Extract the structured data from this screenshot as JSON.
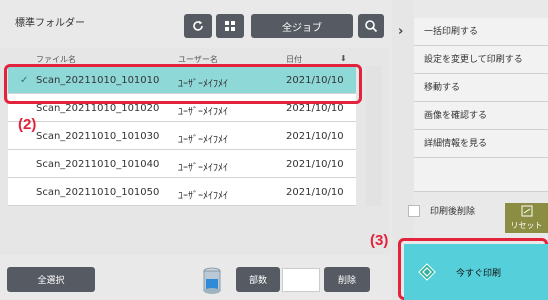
{
  "header": {
    "folder_title": "標準フォルダー",
    "all_jobs_label": "全ジョブ"
  },
  "columns": {
    "name": "ファイル名",
    "user": "ユーザー名",
    "date": "日付"
  },
  "files": [
    {
      "name": "Scan_20211010_101010",
      "user": "ﾕｰｻﾞｰﾒｲﾌﾒｲ",
      "date": "2021/10/10",
      "selected": true,
      "check": "✓"
    },
    {
      "name": "Scan_20211010_101020",
      "user": "ﾕｰｻﾞｰﾒｲﾌﾒｲ",
      "date": "2021/10/10",
      "selected": false,
      "check": ""
    },
    {
      "name": "Scan_20211010_101030",
      "user": "ﾕｰｻﾞｰﾒｲﾌﾒｲ",
      "date": "2021/10/10",
      "selected": false,
      "check": ""
    },
    {
      "name": "Scan_20211010_101040",
      "user": "ﾕｰｻﾞｰﾒｲﾌﾒｲ",
      "date": "2021/10/10",
      "selected": false,
      "check": ""
    },
    {
      "name": "Scan_20211010_101050",
      "user": "ﾕｰｻﾞｰﾒｲﾌﾒｲ",
      "date": "2021/10/10",
      "selected": false,
      "check": ""
    }
  ],
  "callouts": {
    "step2": "(2)",
    "step3": "(3)"
  },
  "bottom": {
    "select_all": "全選択",
    "copies": "部数",
    "copies_value": "",
    "delete": "削除"
  },
  "side_menu": {
    "items": [
      "一括印刷する",
      "設定を変更して印刷する",
      "移動する",
      "画像を確認する",
      "詳細情報を見る"
    ]
  },
  "delete_after_print": "印刷後削除",
  "reset_label": "リセット",
  "start_print": "今すぐ印刷",
  "colors": {
    "selected_row": "#8fd8d8",
    "dark_button": "#565b63",
    "highlight": "#e2233b",
    "start_button": "#55cfd9",
    "reset_button": "#8a8d42"
  }
}
